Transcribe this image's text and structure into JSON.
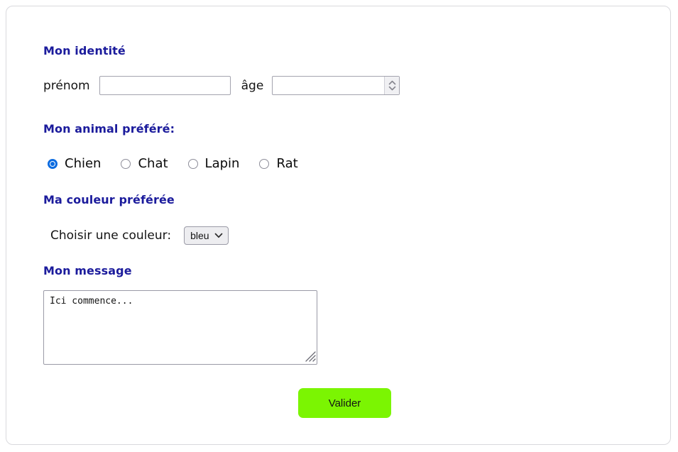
{
  "form": {
    "identity": {
      "heading": "Mon identité",
      "firstname_label": "prénom",
      "firstname_value": "",
      "firstname_placeholder": "",
      "age_label": "âge",
      "age_value": "",
      "age_placeholder": "",
      "spinner_up_icon": "chevron-up-icon",
      "spinner_down_icon": "chevron-down-icon"
    },
    "pet": {
      "heading": "Mon animal préféré:",
      "selected": "Chien",
      "options": [
        {
          "label": "Chien",
          "checked": true
        },
        {
          "label": "Chat",
          "checked": false
        },
        {
          "label": "Lapin",
          "checked": false
        },
        {
          "label": "Rat",
          "checked": false
        }
      ]
    },
    "color": {
      "heading": "Ma couleur préférée",
      "label": "Choisir une couleur:",
      "selected": "bleu",
      "options": [
        "bleu"
      ],
      "arrow_icon": "chevron-down-icon"
    },
    "message": {
      "heading": "Mon message",
      "value": "Ici commence...",
      "placeholder": "",
      "resize_icon": "resize-grip-icon"
    },
    "submit_label": "Valider"
  },
  "colors": {
    "heading": "#1b1b9c",
    "radio_checked": "#0d6ce0",
    "submit_background": "#7bf502",
    "card_border": "#d9d9dd",
    "input_border": "#a3a3ae"
  }
}
